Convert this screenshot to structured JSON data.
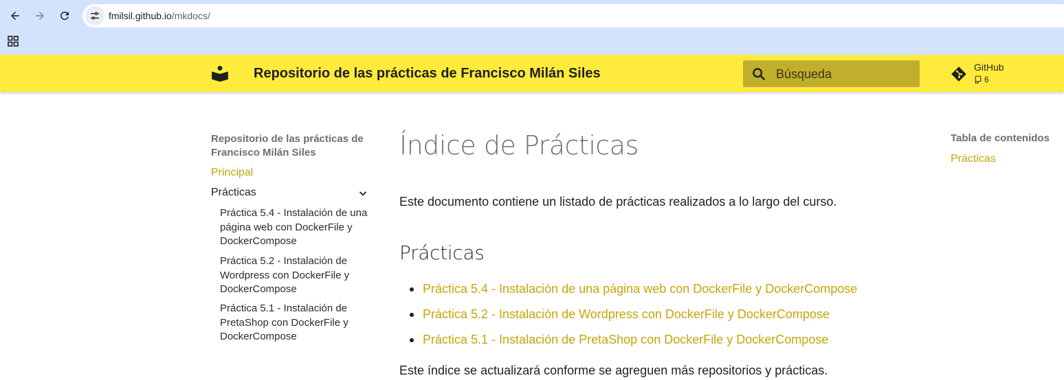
{
  "browser": {
    "url_host": "fmilsil.github.io",
    "url_path": "/mkdocs/"
  },
  "header": {
    "title": "Repositorio de las prácticas de Francisco Milán Siles",
    "search_placeholder": "Búsqueda",
    "repo_name": "GitHub",
    "repo_forks": "6"
  },
  "nav": {
    "title": "Repositorio de las prácticas de Francisco Milán Siles",
    "principal": "Principal",
    "section": "Prácticas",
    "items": [
      "Práctica 5.4 - Instalación de una página web con DockerFile y DockerCompose",
      "Práctica 5.2 - Instalación de Wordpress con DockerFile y DockerCompose",
      "Práctica 5.1 - Instalación de PretaShop con DockerFile y DockerCompose"
    ]
  },
  "content": {
    "h1": "Índice de Prácticas",
    "intro": "Este documento contiene un listado de prácticas realizados a lo largo del curso.",
    "h2": "Prácticas",
    "links": [
      "Práctica 5.4 - Instalación de una página web con DockerFile y DockerCompose",
      "Práctica 5.2 - Instalación de Wordpress con DockerFile y DockerCompose",
      "Práctica 5.1 - Instalación de PretaShop con DockerFile y DockerCompose"
    ],
    "outro": "Este índice se actualizará conforme se agreguen más repositorios y prácticas."
  },
  "toc": {
    "title": "Tabla de contenidos",
    "items": [
      "Prácticas"
    ]
  },
  "colors": {
    "header_bg": "#ffeb3b",
    "accent": "#c5a50a",
    "chrome_bg": "#d3e3fd"
  }
}
